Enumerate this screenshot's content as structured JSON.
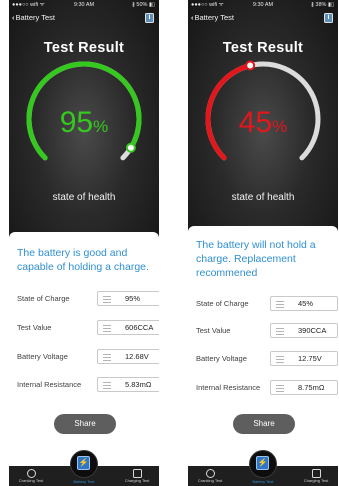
{
  "screens": [
    {
      "status": {
        "carrier": "●●●○○ wifi ᯤ",
        "time": "9:30 AM",
        "battery": "∦ 50% ▮▯"
      },
      "nav": {
        "back_label": "Battery Test"
      },
      "title": "Test Result",
      "gauge": {
        "percent": 95,
        "percent_text": "95",
        "unit": "%",
        "color": "#35c81e",
        "label": "state of health"
      },
      "message": "The battery is good and capable of holding a charge.",
      "rows": [
        {
          "label": "State of Charge",
          "value": "95%"
        },
        {
          "label": "Test Value",
          "value": "606CCA"
        },
        {
          "label": "Battery Voltage",
          "value": "12.68V"
        },
        {
          "label": "Internal Resistance",
          "value": "5.83mΩ"
        }
      ],
      "share_label": "Share",
      "tabs": [
        {
          "label": "Cranking Test",
          "icon": "cranking-icon"
        },
        {
          "label": "Battery Test",
          "icon": "battery-test-icon"
        },
        {
          "label": "Charging Test",
          "icon": "charging-icon"
        }
      ]
    },
    {
      "status": {
        "carrier": "●●●○○ wifi ᯤ",
        "time": "9:30 AM",
        "battery": "∦ 38% ▮▯"
      },
      "nav": {
        "back_label": "Battery Test"
      },
      "title": "Test Result",
      "gauge": {
        "percent": 45,
        "percent_text": "45",
        "unit": "%",
        "color": "#e2171c",
        "label": "state of health"
      },
      "message": "The battery will not hold a charge. Replacement recommened",
      "rows": [
        {
          "label": "State of Charge",
          "value": "45%"
        },
        {
          "label": "Test Value",
          "value": "390CCA"
        },
        {
          "label": "Battery Voltage",
          "value": "12.75V"
        },
        {
          "label": "Internal Resistance",
          "value": "8.75mΩ"
        }
      ],
      "share_label": "Share",
      "tabs": [
        {
          "label": "Cranking Test",
          "icon": "cranking-icon"
        },
        {
          "label": "Battery Test",
          "icon": "battery-test-icon"
        },
        {
          "label": "Charging Test",
          "icon": "charging-icon"
        }
      ]
    }
  ]
}
